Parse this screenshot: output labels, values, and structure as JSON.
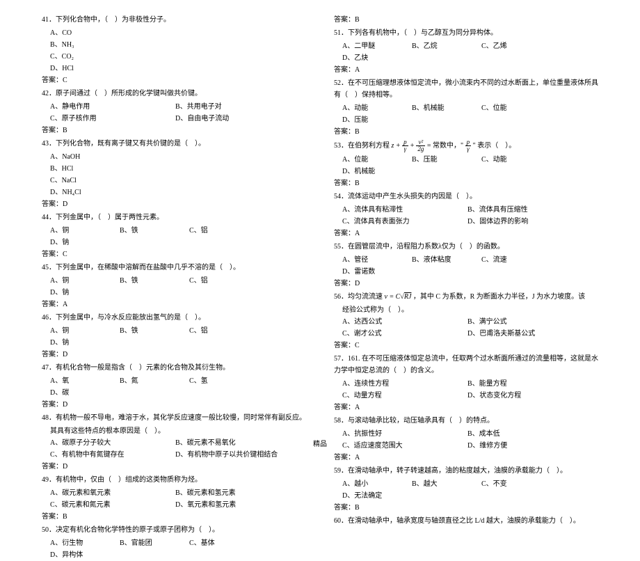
{
  "footer": "精品",
  "left": {
    "q41": {
      "stem": "41．下列化合物中，（　）为非极性分子。",
      "a": "A、CO",
      "b": "B、NH₃",
      "c": "C、CO₂",
      "d": "D、HCl",
      "ans": "答案：C"
    },
    "q42": {
      "stem": "42．原子间通过（　）所形成的化学键叫做共价键。",
      "a": "A、静电作用",
      "b": "B、共用电子对",
      "c": "C、原子核作用",
      "d": "D、自由电子流动",
      "ans": "答案：B"
    },
    "q43": {
      "stem": "43．下列化合物，既有离子键又有共价键的是（　）。",
      "a": "A、NaOH",
      "b": "B、HCl",
      "c": "C、NaCl",
      "d": "D、NH₄Cl",
      "ans": "答案：D"
    },
    "q44": {
      "stem": "44．下列金属中，（　）属于两性元素。",
      "a": "A、铜",
      "b": "B、铁",
      "c": "C、铝",
      "d": "D、钠",
      "ans": "答案：C"
    },
    "q45": {
      "stem": "45．下列金属中，在稀酸中溶解而在盐酸中几乎不溶的是（　）。",
      "a": "A、铜",
      "b": "B、铁",
      "c": "C、铝",
      "d": "D、钠",
      "ans": "答案：A"
    },
    "q46": {
      "stem": "46．下列金属中，与冷水反应能放出氢气的是（　）。",
      "a": "A、铜",
      "b": "B、铁",
      "c": "C、铝",
      "d": "D、钠",
      "ans": "答案：D"
    },
    "q47": {
      "stem": "47．有机化合物一般是指含（　）元素的化合物及其衍生物。",
      "a": "A、氧",
      "b": "B、氮",
      "c": "C、氢",
      "d": "D、碳",
      "ans": "答案：D"
    },
    "q48": {
      "stem": "48．有机物一般不导电，难溶于水，其化学反应速度一般比较慢，同时常伴有副反应。",
      "sub": "其具有这些特点的根本原因是（　）。",
      "a": "A、碳原子分子较大",
      "b": "B、碳元素不易氧化",
      "c": "C、有机物中有氮键存在",
      "d": "D、有机物中原子以共价键相结合",
      "ans": "答案：D"
    },
    "q49": {
      "stem": "49．有机物中，仅由（　）组成的这类物质称为烃。",
      "a": "A、碳元素和氧元素",
      "b": "B、碳元素和氢元素",
      "c": "C、碳元素和氮元素",
      "d": "D、氧元素和氢元素",
      "ans": "答案：B"
    },
    "q50": {
      "stem": "50．决定有机化合物化学特性的原子或原子团称为（　）。",
      "a": "A、衍生物",
      "b": "B、官能团",
      "c": "C、基体",
      "d": "D、异构体"
    }
  },
  "right": {
    "q50ans": "答案：B",
    "q51": {
      "stem": "51．下列各有机物中，（　）与乙醇互为同分异构体。",
      "a": "A、二甲醚",
      "b": "B、乙烷",
      "c": "C、乙烯",
      "d": "D、乙炔",
      "ans": "答案：A"
    },
    "q52": {
      "stem": "52．在不可压缩理想液体恒定流中，微小流束内不同的过水断面上，单位重量液体所具有（　）保持相等。",
      "a": "A、动能",
      "b": "B、机械能",
      "c": "C、位能",
      "d": "D、压能",
      "ans": "答案：B"
    },
    "q53": {
      "pre": "53．在伯努利方程",
      "mid": "= 常数中，\"",
      "post": "\" 表示（　）。",
      "a": "A、位能",
      "b": "B、压能",
      "c": "C、动能",
      "d": "D、机械能",
      "ans": "答案：B"
    },
    "q54": {
      "stem": "54．流体运动中产生水头损失的内因是（　）。",
      "a": "A、流体具有粘滞性",
      "b": "B、流体具有压缩性",
      "c": "C、流体具有表面张力",
      "d": "D、固体边界的影响",
      "ans": "答案：A"
    },
    "q55": {
      "stem": "55．在圆管层流中，沿程阻力系数λ仅为（　）的函数。",
      "a": "A、管径",
      "b": "B、液体粘度",
      "c": "C、流速",
      "d": "D、雷诺数",
      "ans": "答案：D"
    },
    "q56": {
      "pre": "56．均匀流流速",
      "post": " ，其中 C 为系数，R 为断面水力半径，J 为水力坡度。该",
      "sub": "经验公式称为（　）。",
      "a": "A、达西公式",
      "b": "B、满宁公式",
      "c": "C、谢才公式",
      "d": "D、巴甫洛夫斯基公式",
      "ans": "答案：C"
    },
    "q57": {
      "stem": "57．161. 在不可压缩液体恒定总流中，任取两个过水断面所通过的流量相等，这就是水力学中恒定总流的（　）的含义。",
      "a": "A、连续性方程",
      "b": "B、能量方程",
      "c": "C、动量方程",
      "d": "D、状态变化方程",
      "ans": "答案：A"
    },
    "q58": {
      "stem": "58．与滚动轴承比较，动压轴承具有（　）的特点。",
      "a": "A、抗振性好",
      "b": "B、成本低",
      "c": "C、适应速度范围大",
      "d": "D、维修方便",
      "ans": "答案：A"
    },
    "q59": {
      "stem": "59．在滑动轴承中，转子转速越高，油的粘度越大，油膜的承载能力（　）。",
      "a": "A、越小",
      "b": "B、越大",
      "c": "C、不变",
      "d": "D、无法确定",
      "ans": "答案：B"
    },
    "q60": {
      "stem": "60．在滑动轴承中，轴承宽度与轴颈直径之比 L/d 越大，油膜的承载能力（　）。"
    }
  }
}
